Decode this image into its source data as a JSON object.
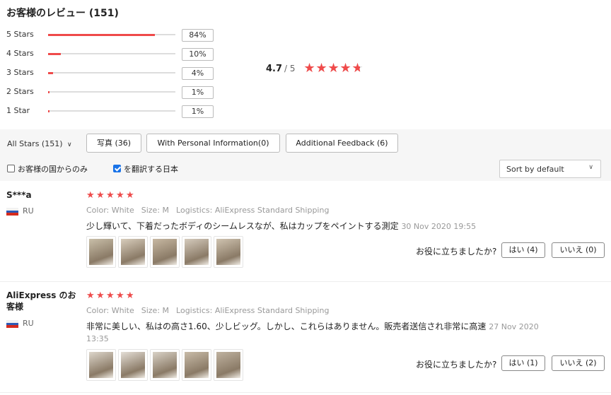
{
  "title": "お客様のレビュー (151)",
  "distribution": [
    {
      "label": "5 Stars",
      "percent_text": "84%",
      "value": 84
    },
    {
      "label": "4 Stars",
      "percent_text": "10%",
      "value": 10
    },
    {
      "label": "3 Stars",
      "percent_text": "4%",
      "value": 4
    },
    {
      "label": "2 Stars",
      "percent_text": "1%",
      "value": 1
    },
    {
      "label": "1 Star",
      "percent_text": "1%",
      "value": 1
    }
  ],
  "summary": {
    "score": "4.7",
    "outof": "/ 5",
    "rating": 4.7
  },
  "filters": {
    "all_stars": "All Stars (151)",
    "photos": "写真 (36)",
    "personal": "With Personal Information(0)",
    "additional": "Additional Feedback (6)"
  },
  "options": {
    "my_country": "お客様の国からのみ",
    "translate": "を翻訳する日本",
    "sort": "Sort by default"
  },
  "colors": {
    "accent": "#f04b4b",
    "check": "#1a73e8"
  },
  "reviews": [
    {
      "name": "S***a",
      "country": "RU",
      "rating": 5,
      "color_label": "Color:",
      "color_value": "White",
      "size_label": "Size:",
      "size_value": "M",
      "logistics_label": "Logistics:",
      "logistics_value": "AliExpress Standard Shipping",
      "text": "少し輝いて、下着だったボディのシームレスなが、私はカップをペイントする測定",
      "date": "30 Nov 2020 19:55",
      "helpful_label": "お役に立ちましたか?",
      "yes_label": "はい (4)",
      "no_label": "いいえ (0)"
    },
    {
      "name": "AliExpress のお客様",
      "country": "RU",
      "rating": 4.7,
      "color_label": "Color:",
      "color_value": "White",
      "size_label": "Size:",
      "size_value": "M",
      "logistics_label": "Logistics:",
      "logistics_value": "AliExpress Standard Shipping",
      "text": "非常に美しい、私はの高さ1.60、少しビッグ。しかし、これらはありません。販売者送信され非常に高速",
      "date": "27 Nov 2020 13:35",
      "helpful_label": "お役に立ちましたか?",
      "yes_label": "はい (1)",
      "no_label": "いいえ (2)"
    }
  ]
}
